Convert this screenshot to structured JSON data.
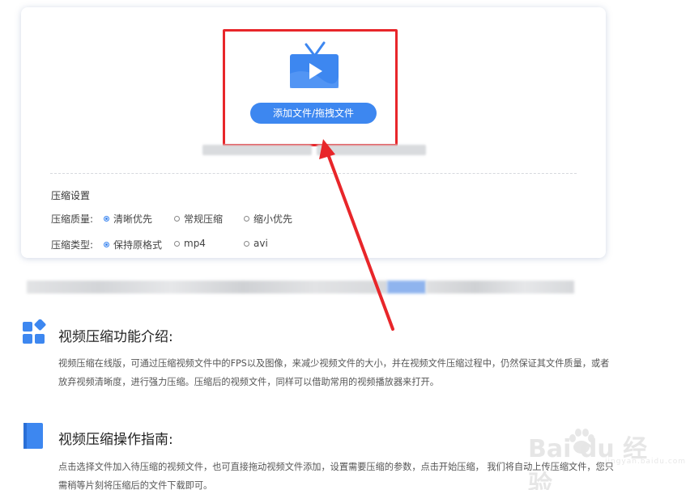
{
  "upload": {
    "button_label": "添加文件/拖拽文件",
    "icon": "tv-icon"
  },
  "settings": {
    "title": "压缩设置",
    "quality": {
      "label": "压缩质量:",
      "options": [
        "清晰优先",
        "常规压缩",
        "缩小优先"
      ],
      "selected": "清晰优先"
    },
    "type": {
      "label": "压缩类型:",
      "options": [
        "保持原格式",
        "mp4",
        "avi"
      ],
      "selected": "保持原格式"
    }
  },
  "sections": [
    {
      "icon": "grid-diamond-icon",
      "title": "视频压缩功能介绍:",
      "body": "视频压缩在线版，可通过压缩视频文件中的FPS以及图像，来减少视频文件的大小，并在视频文件压缩过程中，仍然保证其文件质量，或者放弃视频清晰度，进行强力压缩。压缩后的视频文件，同样可以借助常用的视频播放器来打开。"
    },
    {
      "icon": "book-icon",
      "title": "视频压缩操作指南:",
      "body": "点击选择文件加入待压缩的视频文件，也可直接拖动视频文件添加，设置需要压缩的参数，点击开始压缩， 我们将自动上传压缩文件，您只需稍等片刻将压缩后的文件下载即可。"
    }
  ],
  "watermark": {
    "logo_text": "Bai du 经验",
    "sub_text": "jingyan.baidu.com"
  },
  "colors": {
    "accent": "#3d87f0",
    "highlight_box": "#e8262a",
    "arrow": "#e8262a"
  }
}
